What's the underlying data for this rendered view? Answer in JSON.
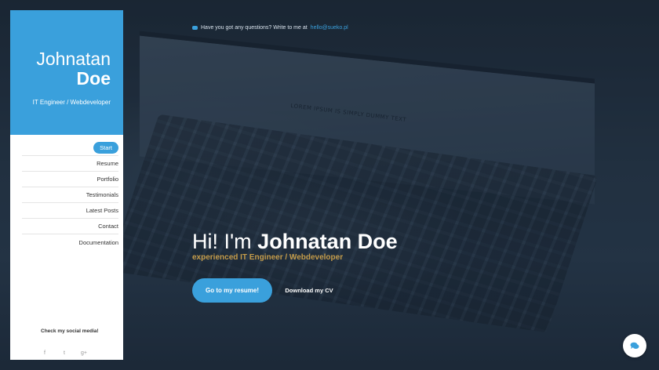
{
  "background": {
    "screen_text": "LOREM IPSUM IS SIMPLY DUMMY TEXT"
  },
  "sidebar": {
    "name_first": "Johnatan",
    "name_last": "Doe",
    "role": "IT Engineer / Webdeveloper",
    "nav": [
      {
        "label": "Start",
        "active": true
      },
      {
        "label": "Resume"
      },
      {
        "label": "Portfolio"
      },
      {
        "label": "Testimonials"
      },
      {
        "label": "Latest Posts"
      },
      {
        "label": "Contact"
      },
      {
        "label": "Documentation"
      }
    ],
    "social_title": "Check my social media!",
    "social_icons": [
      "facebook-icon",
      "twitter-icon",
      "google-plus-icon"
    ],
    "social_glyphs": [
      "f",
      "t",
      "g+"
    ]
  },
  "topbar": {
    "text": "Have you got any questions? Write to me at",
    "email": "hello@sueko.pl"
  },
  "hero": {
    "greeting": "Hi! I'm",
    "name": "Johnatan Doe",
    "subtitle": "experienced IT Engineer / Webdeveloper"
  },
  "buttons": {
    "primary": "Go to my resume!",
    "secondary": "Download my CV"
  },
  "colors": {
    "accent": "#3aa0dc",
    "gold": "#c59c4a"
  }
}
